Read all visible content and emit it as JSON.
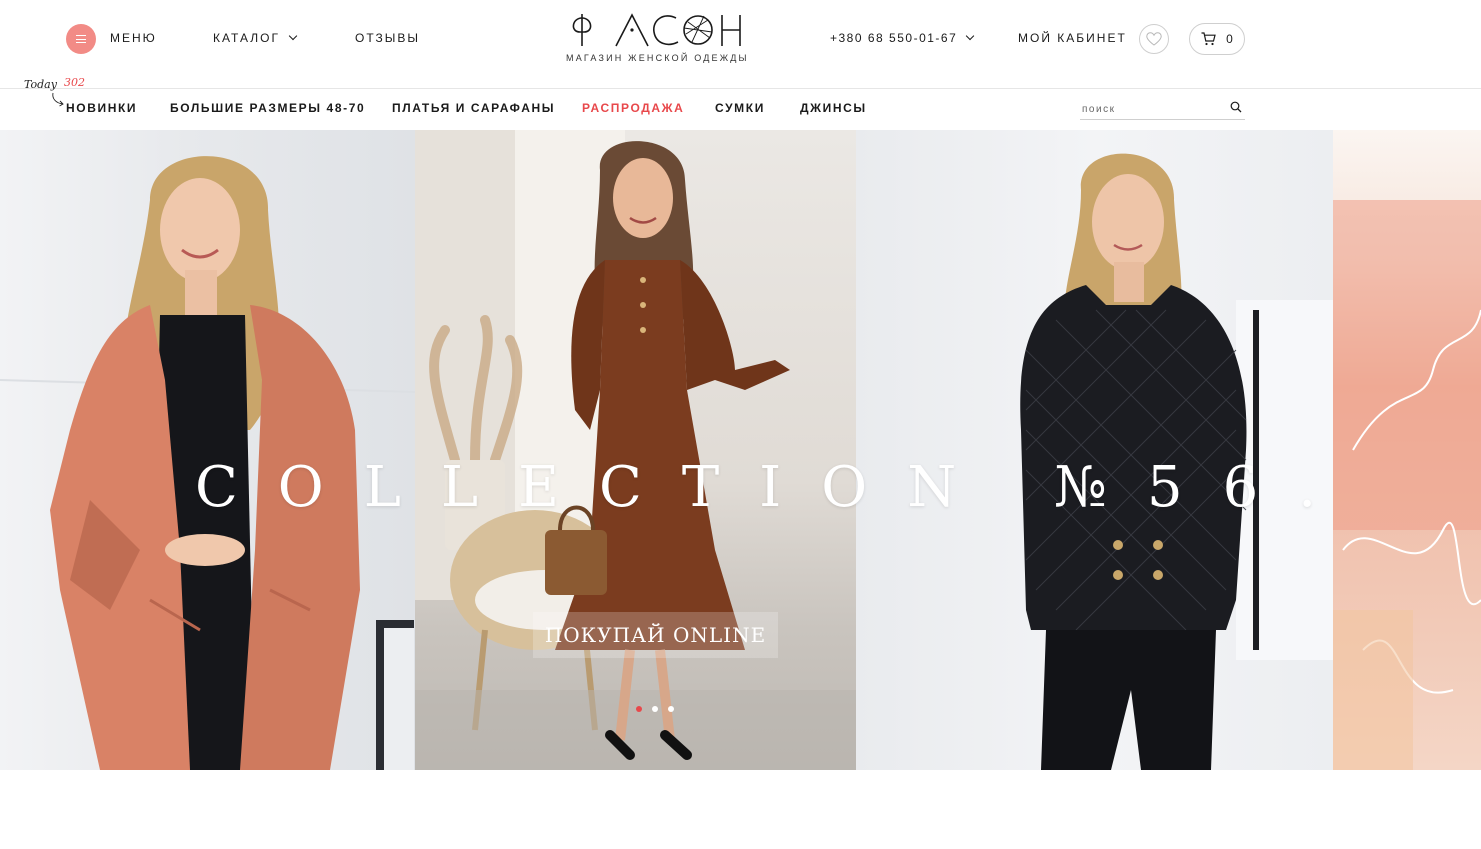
{
  "header": {
    "menu_label": "МЕНЮ",
    "catalog_label": "КАТАЛОГ",
    "reviews_label": "ОТЗЫВЫ",
    "logo_text": "ФАСОН",
    "logo_subtitle": "МАГАЗИН ЖЕНСКОЙ ОДЕЖДЫ",
    "phone": "+380 68 550-01-67",
    "cabinet_label": "МОЙ КАБИНЕТ",
    "cart_count": "0"
  },
  "today_badge": {
    "label": "Today",
    "count": "302"
  },
  "nav": {
    "items": [
      {
        "label": "НОВИНКИ"
      },
      {
        "label": "БОЛЬШИЕ РАЗМЕРЫ 48-70"
      },
      {
        "label": "ПЛАТЬЯ И САРАФАНЫ"
      },
      {
        "label": "РАСПРОДАЖА"
      },
      {
        "label": "СУМКИ"
      },
      {
        "label": "ДЖИНСЫ"
      }
    ]
  },
  "search": {
    "placeholder": "поиск"
  },
  "hero": {
    "title": "COLLECTION №56.",
    "cta_label": "ПОКУПАЙ ONLINE",
    "slide_count": 3,
    "active_slide": 1
  },
  "colors": {
    "accent": "#e8484b",
    "menu_button": "#f28b86",
    "text": "#1a1a1a"
  },
  "icons": [
    "hamburger-icon",
    "chevron-down-icon",
    "heart-icon",
    "cart-icon",
    "search-icon"
  ]
}
